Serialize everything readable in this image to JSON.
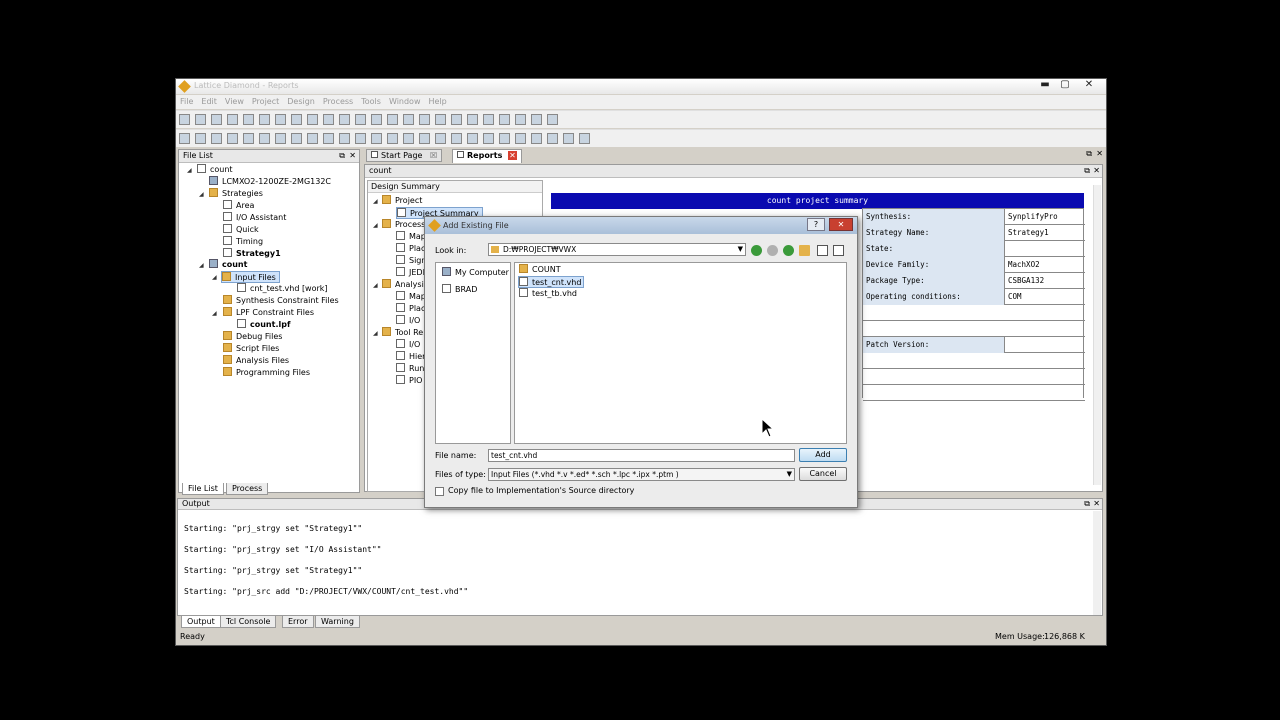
{
  "window": {
    "title": "Lattice Diamond - Reports",
    "min": "▬",
    "max": "▢",
    "close": "✕"
  },
  "menu": [
    "File",
    "Edit",
    "View",
    "Project",
    "Design",
    "Process",
    "Tools",
    "Window",
    "Help"
  ],
  "file_list": {
    "title": "File List",
    "items": [
      {
        "label": "count"
      },
      {
        "label": "LCMXO2-1200ZE-2MG132C"
      },
      {
        "label": "Strategies"
      },
      {
        "label": "Area"
      },
      {
        "label": "I/O Assistant"
      },
      {
        "label": "Quick"
      },
      {
        "label": "Timing"
      },
      {
        "label": "Strategy1"
      },
      {
        "label": "count"
      },
      {
        "label": "Input Files"
      },
      {
        "label": "cnt_test.vhd [work]"
      },
      {
        "label": "Synthesis Constraint Files"
      },
      {
        "label": "LPF Constraint Files"
      },
      {
        "label": "count.lpf"
      },
      {
        "label": "Debug Files"
      },
      {
        "label": "Script Files"
      },
      {
        "label": "Analysis Files"
      },
      {
        "label": "Programming Files"
      }
    ],
    "tabs": [
      "File List",
      "Process"
    ]
  },
  "doc_tabs": {
    "start": "Start Page",
    "reports": "Reports"
  },
  "reports": {
    "breadcrumb": "count",
    "design_summary": "Design Summary",
    "tree": [
      {
        "label": "Project"
      },
      {
        "label": "Project Summary"
      },
      {
        "label": "Process"
      },
      {
        "label": "Map"
      },
      {
        "label": "Place"
      },
      {
        "label": "Signal"
      },
      {
        "label": "JEDEC"
      },
      {
        "label": "Analysis"
      },
      {
        "label": "Map"
      },
      {
        "label": "Place"
      },
      {
        "label": "I/O"
      },
      {
        "label": "Tool Rep"
      },
      {
        "label": "I/O"
      },
      {
        "label": "Hier"
      },
      {
        "label": "Run"
      },
      {
        "label": "PIO"
      }
    ],
    "summary_title": "count project summary",
    "rows": [
      {
        "k": "Synthesis:",
        "v": "SynplifyPro"
      },
      {
        "k": "Strategy Name:",
        "v": "Strategy1"
      },
      {
        "k": "State:",
        "v": ""
      },
      {
        "k": "Device Family:",
        "v": "MachXO2"
      },
      {
        "k": "Package Type:",
        "v": "CSBGA132"
      },
      {
        "k": "Operating conditions:",
        "v": "COM"
      },
      {
        "k": "",
        "v": ""
      },
      {
        "k": "",
        "v": ""
      },
      {
        "k": "Patch Version:",
        "v": ""
      }
    ]
  },
  "dialog": {
    "title": "Add Existing File",
    "help": "?",
    "close": "✕",
    "look_in_label": "Look in:",
    "look_in_value": "D:₩PROJECT₩VWX",
    "places": [
      "My Computer",
      "BRAD"
    ],
    "files": [
      {
        "name": "COUNT"
      },
      {
        "name": "test_cnt.vhd"
      },
      {
        "name": "test_tb.vhd"
      }
    ],
    "file_name_label": "File name:",
    "file_name_value": "test_cnt.vhd",
    "file_type_label": "Files of type:",
    "file_type_value": "Input Files (*.vhd *.v *.ed* *.sch *.lpc *.ipx *.ptm )",
    "add": "Add",
    "cancel": "Cancel",
    "copy_label": "Copy file to Implementation's Source directory"
  },
  "output": {
    "title": "Output",
    "lines": [
      "Starting: \"prj_strgy set \"Strategy1\"\"",
      "Starting: \"prj_strgy set \"I/O Assistant\"\"",
      "Starting: \"prj_strgy set \"Strategy1\"\"",
      "Starting: \"prj_src add \"D:/PROJECT/VWX/COUNT/cnt_test.vhd\"\""
    ],
    "tabs": [
      "Output",
      "Tcl Console",
      "Error",
      "Warning"
    ]
  },
  "status": {
    "left": "Ready",
    "mem_label": "Mem Usage:",
    "mem_value": "126,868 K"
  }
}
